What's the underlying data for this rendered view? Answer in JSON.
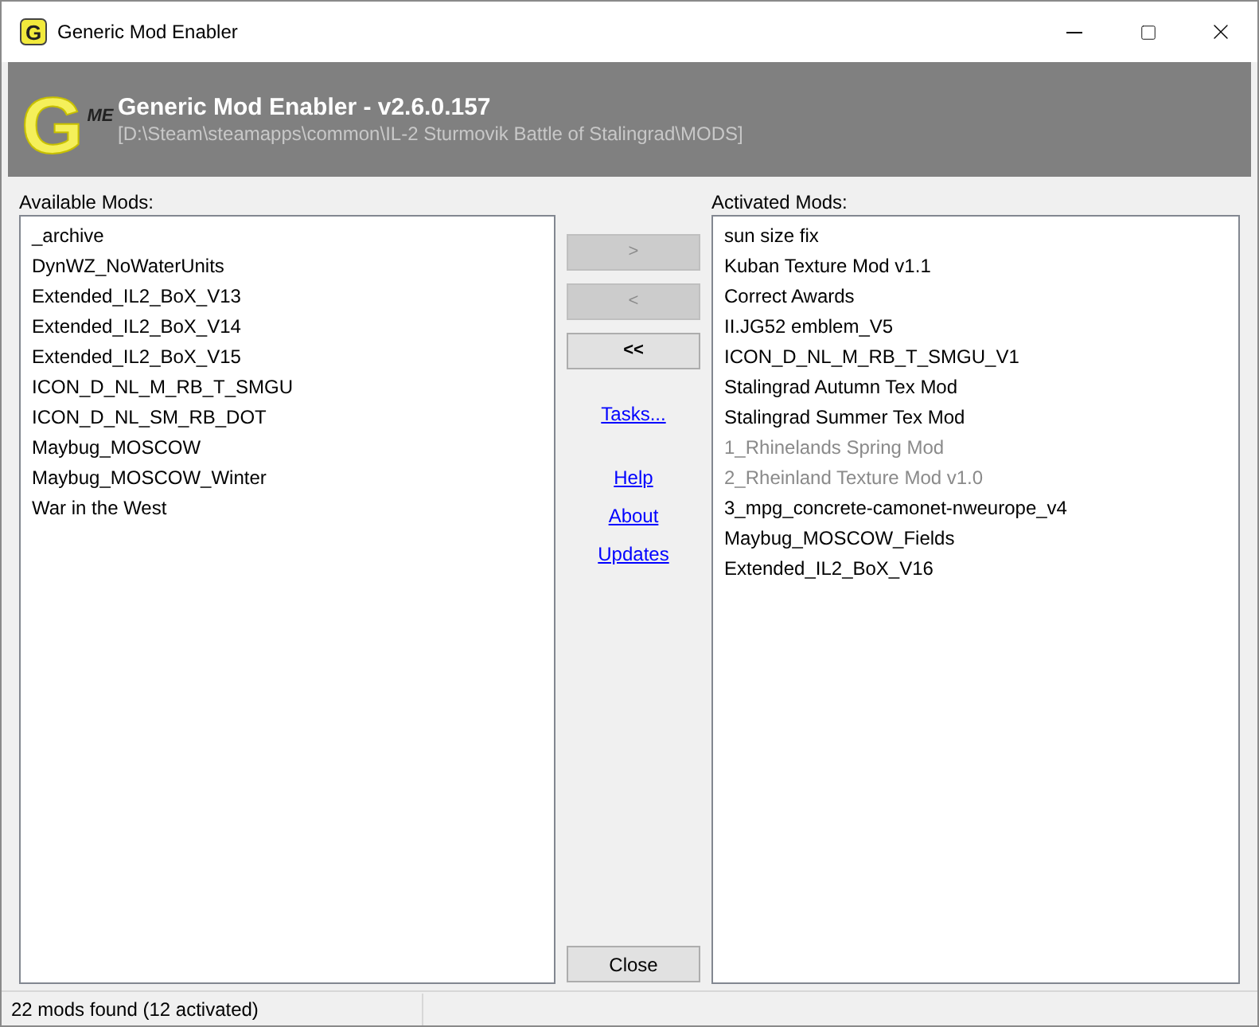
{
  "window": {
    "title": "Generic Mod Enabler",
    "icon_letter": "G"
  },
  "header": {
    "logo": {
      "letter": "G",
      "sub": "ME"
    },
    "title": "Generic Mod Enabler - v2.6.0.157",
    "path": "[D:\\Steam\\steamapps\\common\\IL-2 Sturmovik Battle of Stalingrad\\MODS]"
  },
  "available_mods": {
    "label": "Available Mods:",
    "items": [
      {
        "name": "_archive"
      },
      {
        "name": "DynWZ_NoWaterUnits"
      },
      {
        "name": "Extended_IL2_BoX_V13"
      },
      {
        "name": "Extended_IL2_BoX_V14"
      },
      {
        "name": "Extended_IL2_BoX_V15"
      },
      {
        "name": "ICON_D_NL_M_RB_T_SMGU"
      },
      {
        "name": "ICON_D_NL_SM_RB_DOT"
      },
      {
        "name": "Maybug_MOSCOW"
      },
      {
        "name": "Maybug_MOSCOW_Winter"
      },
      {
        "name": "War in the West"
      }
    ]
  },
  "buttons": [
    {
      "label": ">",
      "disabled": true
    },
    {
      "label": "<",
      "disabled": true
    },
    {
      "label": "<<",
      "disabled": false
    }
  ],
  "links": [
    {
      "label": "Tasks..."
    },
    {
      "label": "Help"
    },
    {
      "label": "About"
    },
    {
      "label": "Updates"
    }
  ],
  "close_button": {
    "label": "Close"
  },
  "activated_mods": {
    "label": "Activated Mods:",
    "items": [
      {
        "name": "sun size fix",
        "disabled": false
      },
      {
        "name": "Kuban Texture Mod v1.1",
        "disabled": false
      },
      {
        "name": "Correct Awards",
        "disabled": false
      },
      {
        "name": "II.JG52 emblem_V5",
        "disabled": false
      },
      {
        "name": "ICON_D_NL_M_RB_T_SMGU_V1",
        "disabled": false
      },
      {
        "name": "Stalingrad Autumn Tex Mod",
        "disabled": false
      },
      {
        "name": "Stalingrad Summer Tex Mod",
        "disabled": false
      },
      {
        "name": "1_Rhinelands Spring Mod",
        "disabled": true
      },
      {
        "name": "2_Rheinland Texture Mod v1.0",
        "disabled": true
      },
      {
        "name": "3_mpg_concrete-camonet-nweurope_v4",
        "disabled": false
      },
      {
        "name": "Maybug_MOSCOW_Fields",
        "disabled": false
      },
      {
        "name": "Extended_IL2_BoX_V16",
        "disabled": false
      }
    ]
  },
  "status_bar": {
    "text": "22 mods found (12 activated)"
  }
}
